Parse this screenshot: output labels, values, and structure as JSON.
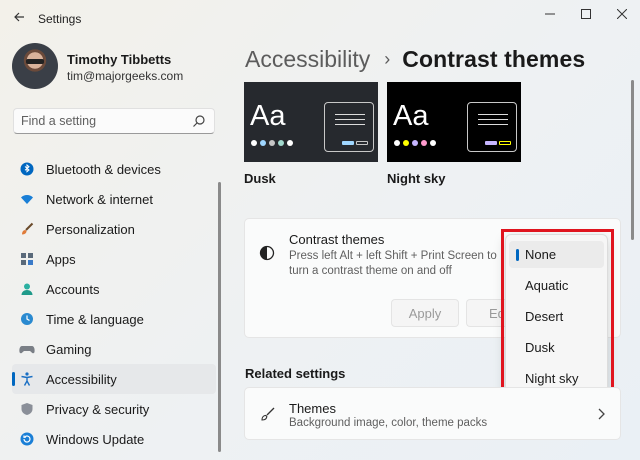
{
  "window": {
    "title": "Settings",
    "controls": {
      "minimize": "—",
      "maximize": "☐",
      "close": "✕"
    }
  },
  "profile": {
    "name": "Timothy Tibbetts",
    "email": "tim@majorgeeks.com"
  },
  "search": {
    "placeholder": "Find a setting"
  },
  "sidebar": {
    "items": [
      {
        "label": "Bluetooth & devices",
        "icon": "bluetooth-icon"
      },
      {
        "label": "Network & internet",
        "icon": "wifi-icon"
      },
      {
        "label": "Personalization",
        "icon": "brush-icon"
      },
      {
        "label": "Apps",
        "icon": "apps-icon"
      },
      {
        "label": "Accounts",
        "icon": "person-icon"
      },
      {
        "label": "Time & language",
        "icon": "globe-clock-icon"
      },
      {
        "label": "Gaming",
        "icon": "gamepad-icon"
      },
      {
        "label": "Accessibility",
        "icon": "accessibility-icon",
        "selected": true
      },
      {
        "label": "Privacy & security",
        "icon": "shield-icon"
      },
      {
        "label": "Windows Update",
        "icon": "update-icon"
      }
    ]
  },
  "header": {
    "parent": "Accessibility",
    "separator": "›",
    "current": "Contrast themes"
  },
  "previews": [
    {
      "name": "Dusk",
      "aa": "Aa",
      "colors": [
        "#ffffff",
        "#9fd6ff",
        "#c6c6c6",
        "#a2d9ce",
        "#ffffff"
      ]
    },
    {
      "name": "Night sky",
      "aa": "Aa",
      "colors": [
        "#ffffff",
        "#ffff00",
        "#c6b6ff",
        "#ff9acd",
        "#ffffff"
      ]
    }
  ],
  "contrast_card": {
    "title": "Contrast themes",
    "description": "Press left Alt + left Shift + Print Screen to turn a contrast theme on and off",
    "apply_label": "Apply",
    "edit_label": "Edit"
  },
  "dropdown": {
    "options": [
      "None",
      "Aquatic",
      "Desert",
      "Dusk",
      "Night sky"
    ],
    "selected": "None"
  },
  "related": {
    "heading": "Related settings",
    "themes_title": "Themes",
    "themes_desc": "Background image, color, theme packs"
  },
  "colors": {
    "accent": "#0067c0",
    "highlight": "#e0141e"
  }
}
